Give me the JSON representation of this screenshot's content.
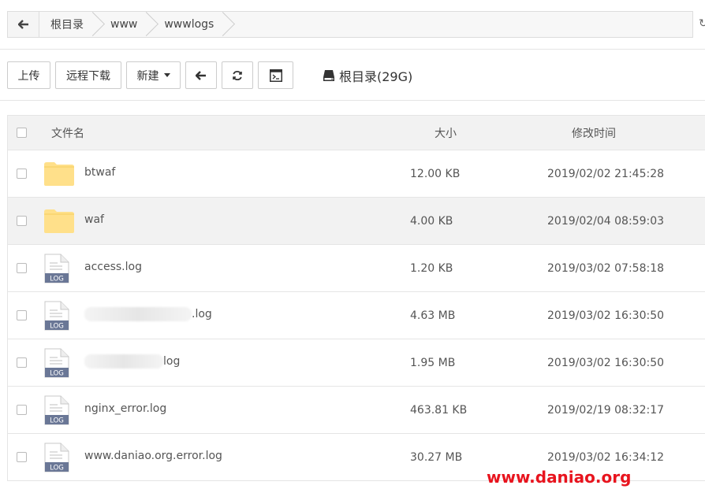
{
  "breadcrumb": {
    "items": [
      "根目录",
      "www",
      "wwwlogs"
    ]
  },
  "toolbar": {
    "upload": "上传",
    "remote_download": "远程下载",
    "new": "新建",
    "disk_label": "根目录(29G)"
  },
  "table": {
    "headers": {
      "name": "文件名",
      "size": "大小",
      "modified": "修改时间"
    },
    "rows": [
      {
        "type": "folder",
        "name": "btwaf",
        "size": "12.00 KB",
        "modified": "2019/02/02 21:45:28"
      },
      {
        "type": "folder",
        "name": "waf",
        "size": "4.00 KB",
        "modified": "2019/02/04 08:59:03"
      },
      {
        "type": "log",
        "name": "access.log",
        "size": "1.20 KB",
        "modified": "2019/03/02 07:58:18"
      },
      {
        "type": "log",
        "name": ".log",
        "size": "4.63 MB",
        "modified": "2019/03/02 16:30:50"
      },
      {
        "type": "log",
        "name": "log",
        "size": "1.95 MB",
        "modified": "2019/03/02 16:30:50"
      },
      {
        "type": "log",
        "name": "nginx_error.log",
        "size": "463.81 KB",
        "modified": "2019/02/19 08:32:17"
      },
      {
        "type": "log",
        "name": "www.daniao.org.error.log",
        "size": "30.27 MB",
        "modified": "2019/03/02 16:34:12"
      }
    ],
    "log_badge": "LOG"
  },
  "watermark": "www.daniao.org",
  "colors": {
    "folder": "#ffe08a",
    "log_badge": "#6a7796",
    "watermark": "#e8141e"
  }
}
